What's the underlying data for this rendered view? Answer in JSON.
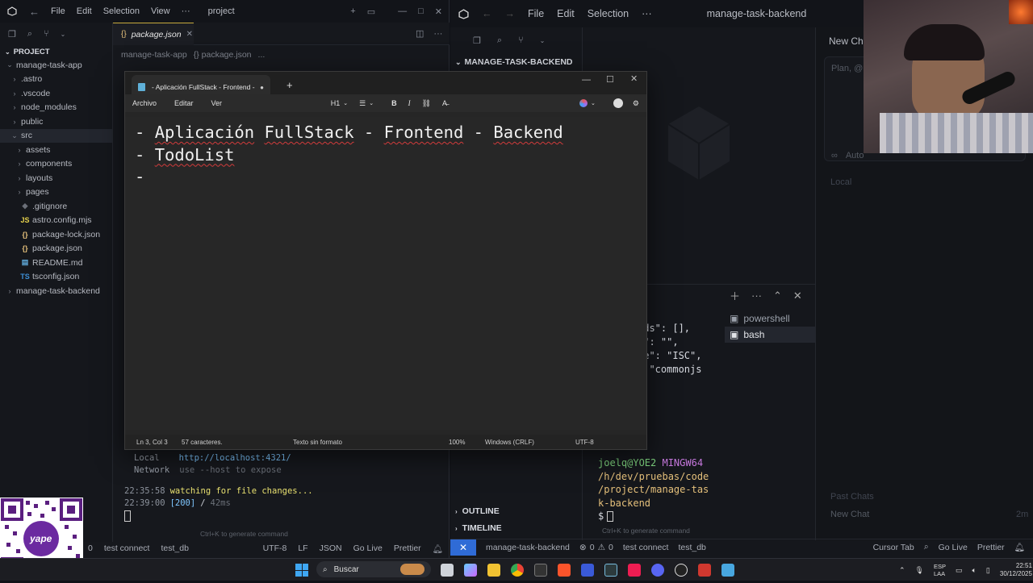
{
  "left_window": {
    "menu": [
      "File",
      "Edit",
      "Selection",
      "View"
    ],
    "title": "project",
    "sidebar_header": "PROJECT",
    "tree": [
      {
        "label": "manage-task-app",
        "kind": "folder-open",
        "indent": 0
      },
      {
        "label": ".astro",
        "kind": "folder",
        "indent": 1
      },
      {
        "label": ".vscode",
        "kind": "folder",
        "indent": 1
      },
      {
        "label": "node_modules",
        "kind": "folder",
        "indent": 1
      },
      {
        "label": "public",
        "kind": "folder",
        "indent": 1
      },
      {
        "label": "src",
        "kind": "folder-open",
        "indent": 1
      },
      {
        "label": "assets",
        "kind": "folder",
        "indent": 2
      },
      {
        "label": "components",
        "kind": "folder",
        "indent": 2
      },
      {
        "label": "layouts",
        "kind": "folder",
        "indent": 2
      },
      {
        "label": "pages",
        "kind": "folder",
        "indent": 2
      },
      {
        "label": ".gitignore",
        "kind": "git",
        "indent": 1
      },
      {
        "label": "astro.config.mjs",
        "kind": "js",
        "indent": 1
      },
      {
        "label": "package-lock.json",
        "kind": "json",
        "indent": 1
      },
      {
        "label": "package.json",
        "kind": "json",
        "indent": 1
      },
      {
        "label": "README.md",
        "kind": "md",
        "indent": 1
      },
      {
        "label": "tsconfig.json",
        "kind": "ts",
        "indent": 1
      },
      {
        "label": "manage-task-backend",
        "kind": "folder",
        "indent": 0
      }
    ],
    "active_tab": "package.json",
    "breadcrumb": [
      "manage-task-app",
      "{} package.json",
      "..."
    ],
    "terminal": {
      "local_label": "Local",
      "local_url": "http://localhost:4321/",
      "network_label": "Network",
      "network_value": "use --host to expose",
      "line1_time": "22:35:58",
      "line1_text": "watching for file changes...",
      "line2_time": "22:39:00",
      "line2_status": "[200]",
      "line2_path": "/",
      "line2_ms": "42ms",
      "hint": "Ctrl+K to generate command"
    },
    "status": {
      "problems": "0",
      "db1": "test connect",
      "db2": "test_db",
      "encoding": "UTF-8",
      "eol": "LF",
      "lang": "JSON",
      "golive": "Go Live",
      "prettier": "Prettier"
    }
  },
  "right_window": {
    "menu": [
      "File",
      "Edit",
      "Selection"
    ],
    "title": "manage-task-backend",
    "explorer_header": "MANAGE-TASK-BACKEND",
    "chat_title": "New Cha",
    "chat_placeholder": "Plan, @",
    "auto_label": "Auto",
    "local_label": "Local",
    "past_chats": "Past Chats",
    "new_chat": "New Chat",
    "new_chat_time": "2m",
    "terminal_tabs": [
      "powershell",
      "bash"
    ],
    "code_lines": [
      "rds\": [],",
      "r\": \"\",",
      "se\": \"ISC\",",
      ": \"commonjs"
    ],
    "prompt_user": "joelq@YOE2",
    "prompt_env": "MINGW64",
    "prompt_path": [
      "/h/dev/pruebas/code",
      "/project/manage-tas",
      "k-backend"
    ],
    "prompt_symbol": "$",
    "outline": "OUTLINE",
    "timeline": "TIMELINE",
    "hint": "Ctrl+K to generate command",
    "status": {
      "branch": "manage-task-backend",
      "errors": "0",
      "warnings": "0",
      "db1": "test connect",
      "db2": "test_db",
      "cursor_tab": "Cursor Tab",
      "golive": "Go Live",
      "prettier": "Prettier"
    }
  },
  "notepad": {
    "tab_title": "- Aplicación FullStack - Frontend -",
    "menu": [
      "Archivo",
      "Editar",
      "Ver"
    ],
    "heading": "H1",
    "lines": [
      {
        "dash": "-",
        "parts": [
          {
            "t": "Aplicación",
            "sq": true
          },
          {
            "t": " ",
            "sq": false
          },
          {
            "t": "FullStack",
            "sq": true
          },
          {
            "t": " - ",
            "sq": false
          },
          {
            "t": "Frontend",
            "sq": true
          },
          {
            "t": " - ",
            "sq": false
          },
          {
            "t": "Backend",
            "sq": true
          }
        ]
      },
      {
        "dash": "-",
        "parts": [
          {
            "t": "TodoList",
            "sq": true
          }
        ]
      },
      {
        "dash": "-",
        "parts": []
      }
    ],
    "status": {
      "pos": "Ln 3, Col 3",
      "chars": "57 caracteres.",
      "format": "Texto sin formato",
      "zoom": "100%",
      "eol": "Windows (CRLF)",
      "enc": "UTF-8"
    }
  },
  "taskbar": {
    "search": "Buscar",
    "lang1": "ESP",
    "lang2": "LAA",
    "time": "22:51",
    "date": "30/12/2025"
  },
  "qr": {
    "brand": "yape"
  }
}
